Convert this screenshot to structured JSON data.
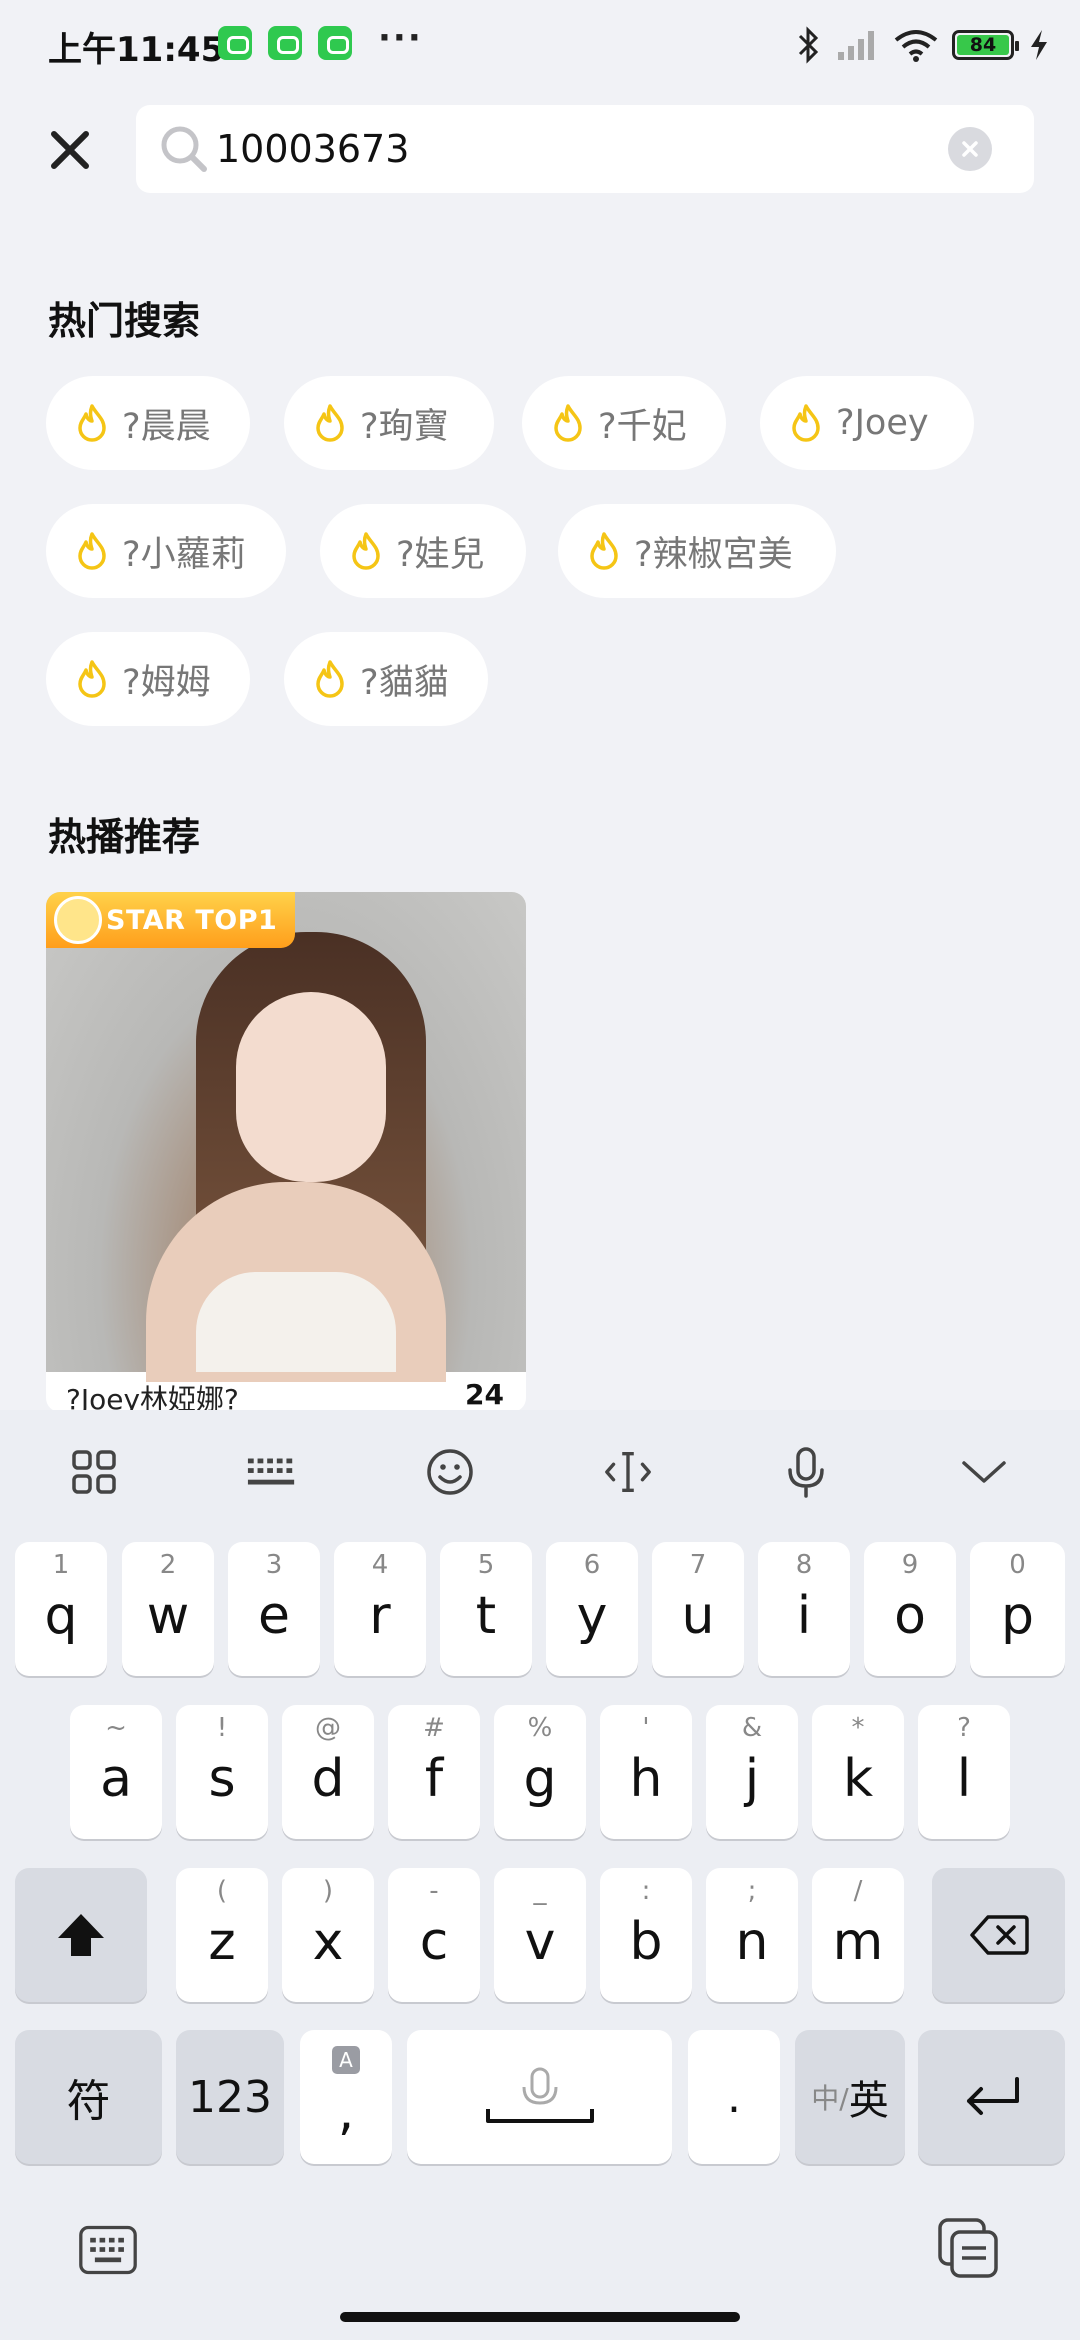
{
  "status_bar": {
    "time": "上午11:45",
    "more": "···",
    "battery": "84",
    "icons": [
      "app-notification-icon",
      "bluetooth-icon",
      "signal-icon",
      "wifi-icon",
      "battery-icon",
      "charging-icon"
    ]
  },
  "search": {
    "query": "10003673",
    "icons": [
      "close-icon",
      "search-icon",
      "clear-icon"
    ]
  },
  "hot_search": {
    "title": "热门搜索",
    "tags": [
      "?晨晨",
      "?珣寶",
      "?千妃",
      "?Joey",
      "?小蘿莉",
      "?娃兒",
      "?辣椒宮美",
      "?姆姆",
      "?貓貓"
    ]
  },
  "recommend": {
    "title": "热播推荐",
    "cards": [
      {
        "badge": "STAR TOP1",
        "title": "?Joey林婭娜?",
        "count": "24"
      }
    ]
  },
  "keyboard": {
    "toolbar": [
      "grid-icon",
      "keyboard-layout-icon",
      "emoji-icon",
      "cursor-icon",
      "microphone-icon",
      "collapse-icon"
    ],
    "row1": [
      {
        "hint": "1",
        "key": "q"
      },
      {
        "hint": "2",
        "key": "w"
      },
      {
        "hint": "3",
        "key": "e"
      },
      {
        "hint": "4",
        "key": "r"
      },
      {
        "hint": "5",
        "key": "t"
      },
      {
        "hint": "6",
        "key": "y"
      },
      {
        "hint": "7",
        "key": "u"
      },
      {
        "hint": "8",
        "key": "i"
      },
      {
        "hint": "9",
        "key": "o"
      },
      {
        "hint": "0",
        "key": "p"
      }
    ],
    "row2": [
      {
        "hint": "~",
        "key": "a"
      },
      {
        "hint": "!",
        "key": "s"
      },
      {
        "hint": "@",
        "key": "d"
      },
      {
        "hint": "#",
        "key": "f"
      },
      {
        "hint": "%",
        "key": "g"
      },
      {
        "hint": "'",
        "key": "h"
      },
      {
        "hint": "&",
        "key": "j"
      },
      {
        "hint": "*",
        "key": "k"
      },
      {
        "hint": "?",
        "key": "l"
      }
    ],
    "row3": [
      {
        "hint": "(",
        "key": "z"
      },
      {
        "hint": ")",
        "key": "x"
      },
      {
        "hint": "-",
        "key": "c"
      },
      {
        "hint": "_",
        "key": "v"
      },
      {
        "hint": ":",
        "key": "b"
      },
      {
        "hint": ";",
        "key": "n"
      },
      {
        "hint": "/",
        "key": "m"
      }
    ],
    "symbols_key": "符",
    "numbers_key": "123",
    "comma_key": ",",
    "period_key": ".",
    "lang_key_cn": "中/",
    "lang_key_en": "英"
  }
}
